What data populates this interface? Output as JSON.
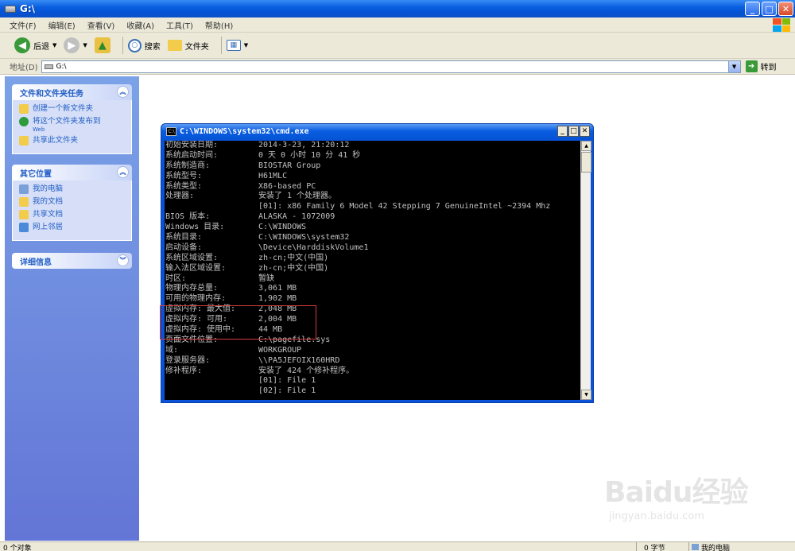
{
  "window": {
    "title": "G:\\"
  },
  "menu": [
    "文件(F)",
    "编辑(E)",
    "查看(V)",
    "收藏(A)",
    "工具(T)",
    "帮助(H)"
  ],
  "toolbar": {
    "back_label": "后退",
    "search_label": "搜索",
    "folders_label": "文件夹"
  },
  "address": {
    "label": "地址(D)",
    "value": "G:\\",
    "go_label": "转到"
  },
  "sidebar": {
    "tasks": {
      "title": "文件和文件夹任务",
      "items": [
        {
          "label": "创建一个新文件夹",
          "icon": "new-folder-icon"
        },
        {
          "label": "将这个文件夹发布到",
          "sub": "Web",
          "icon": "globe-icon"
        },
        {
          "label": "共享此文件夹",
          "icon": "share-folder-icon"
        }
      ]
    },
    "places": {
      "title": "其它位置",
      "items": [
        {
          "label": "我的电脑",
          "icon": "my-computer-icon"
        },
        {
          "label": "我的文档",
          "icon": "my-documents-icon"
        },
        {
          "label": "共享文档",
          "icon": "shared-documents-icon"
        },
        {
          "label": "网上邻居",
          "icon": "network-icon"
        }
      ]
    },
    "details": {
      "title": "详细信息"
    }
  },
  "cmd": {
    "title": "C:\\WINDOWS\\system32\\cmd.exe",
    "lines": [
      {
        "k": "初始安装日期:",
        "v": "2014-3-23, 21:20:12"
      },
      {
        "k": "系统启动时间:",
        "v": "0 天 0 小时 10 分 41 秒"
      },
      {
        "k": "系统制造商:",
        "v": "BIOSTAR Group"
      },
      {
        "k": "系统型号:",
        "v": "H61MLC"
      },
      {
        "k": "系统类型:",
        "v": "X86-based PC"
      },
      {
        "k": "处理器:",
        "v": "安装了 1 个处理器。"
      },
      {
        "k": "",
        "v": "[01]: x86 Family 6 Model 42 Stepping 7 GenuineIntel ~2394 Mhz"
      },
      {
        "k": "BIOS 版本:",
        "v": "ALASKA - 1072009"
      },
      {
        "k": "Windows 目录:",
        "v": "C:\\WINDOWS"
      },
      {
        "k": "系统目录:",
        "v": "C:\\WINDOWS\\system32"
      },
      {
        "k": "启动设备:",
        "v": "\\Device\\HarddiskVolume1"
      },
      {
        "k": "系统区域设置:",
        "v": "zh-cn;中文(中国)"
      },
      {
        "k": "输入法区域设置:",
        "v": "zh-cn;中文(中国)"
      },
      {
        "k": "时区:",
        "v": "暂缺"
      },
      {
        "k": "物理内存总量:",
        "v": "3,061 MB"
      },
      {
        "k": "可用的物理内存:",
        "v": "1,902 MB"
      },
      {
        "k": "虚拟内存: 最大值:",
        "v": "2,048 MB"
      },
      {
        "k": "虚拟内存: 可用:",
        "v": "2,004 MB"
      },
      {
        "k": "虚拟内存: 使用中:",
        "v": "44 MB"
      },
      {
        "k": "页面文件位置:",
        "v": "C:\\pagefile.sys"
      },
      {
        "k": "域:",
        "v": "WORKGROUP"
      },
      {
        "k": "登录服务器:",
        "v": "\\\\PA5JEFOIX160HRD"
      },
      {
        "k": "修补程序:",
        "v": "安装了 424 个修补程序。"
      },
      {
        "k": "",
        "v": "[01]: File 1"
      },
      {
        "k": "",
        "v": "[02]: File 1"
      }
    ]
  },
  "status": {
    "objects": "0 个对象",
    "size": "0 字节",
    "location": "我的电脑"
  },
  "watermark": {
    "main": "Baidu经验",
    "sub": "jingyan.baidu.com"
  },
  "colors": {
    "xp_blue": "#0a5fe0",
    "sidebar_link": "#215dc6",
    "highlight": "#d63c3c"
  }
}
